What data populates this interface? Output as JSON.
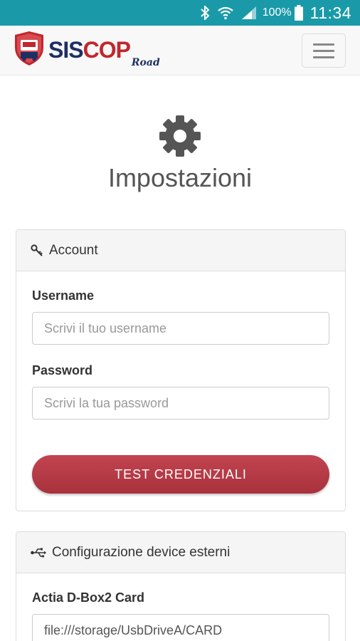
{
  "statusbar": {
    "battery_pct": "100%",
    "time": "11:34"
  },
  "navbar": {
    "logo_sis": "SIS",
    "logo_cop": "COP",
    "logo_road": "Road"
  },
  "page": {
    "title": "Impostazioni"
  },
  "account_panel": {
    "heading": "Account",
    "username_label": "Username",
    "username_placeholder": "Scrivi il tuo username",
    "password_label": "Password",
    "password_placeholder": "Scrivi la tua password",
    "test_button": "TEST CREDENZIALI"
  },
  "devices_panel": {
    "heading": "Configurazione device esterni",
    "dbox_label": "Actia D-Box2 Card",
    "dbox_value": "file:///storage/UsbDriveA/CARD"
  },
  "colors": {
    "statusbar": "#1a9aa8",
    "brand_navy": "#1e2f63",
    "brand_red": "#c1272d",
    "button_red": "#b13b46"
  },
  "icons": [
    "bluetooth-icon",
    "wifi-icon",
    "signal-icon",
    "battery-icon",
    "gear-icon",
    "key-icon",
    "usb-icon",
    "hamburger-icon"
  ]
}
